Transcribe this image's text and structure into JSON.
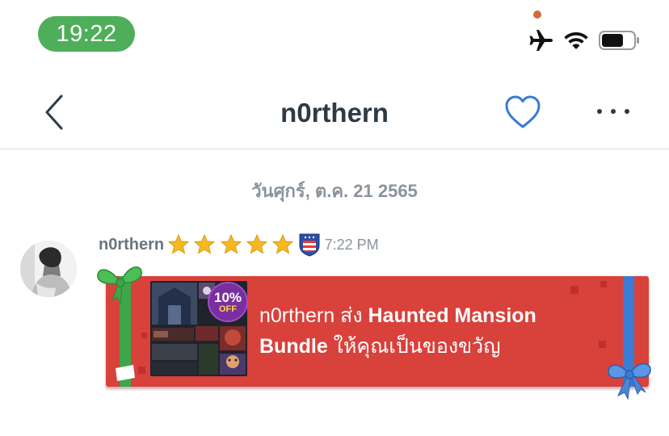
{
  "status_bar": {
    "time": "19:22"
  },
  "nav": {
    "title": "n0rthern",
    "back_icon": "chevron-left-icon",
    "favorite_icon": "heart-outline-icon",
    "more_icon": "ellipsis-icon"
  },
  "conversation": {
    "date": "วันศุกร์, ต.ค. 21 2565",
    "message": {
      "sender": "n0rthern",
      "star_rating": 5,
      "time": "7:22 PM",
      "gift": {
        "discount_pct": "10%",
        "discount_off": "OFF",
        "sender_text": "n0rthern ส่ง",
        "bundle_name_1": "Haunted Mansion",
        "bundle_name_2": "Bundle",
        "gift_suffix": "ให้คุณเป็นของขวัญ"
      }
    }
  },
  "colors": {
    "time_pill": "#4fae5a",
    "heart": "#3a7bd5",
    "gift_card": "#d9413b",
    "ribbon_green": "#3ea64a",
    "ribbon_blue": "#3a7bd5",
    "star": "#f5b921"
  }
}
